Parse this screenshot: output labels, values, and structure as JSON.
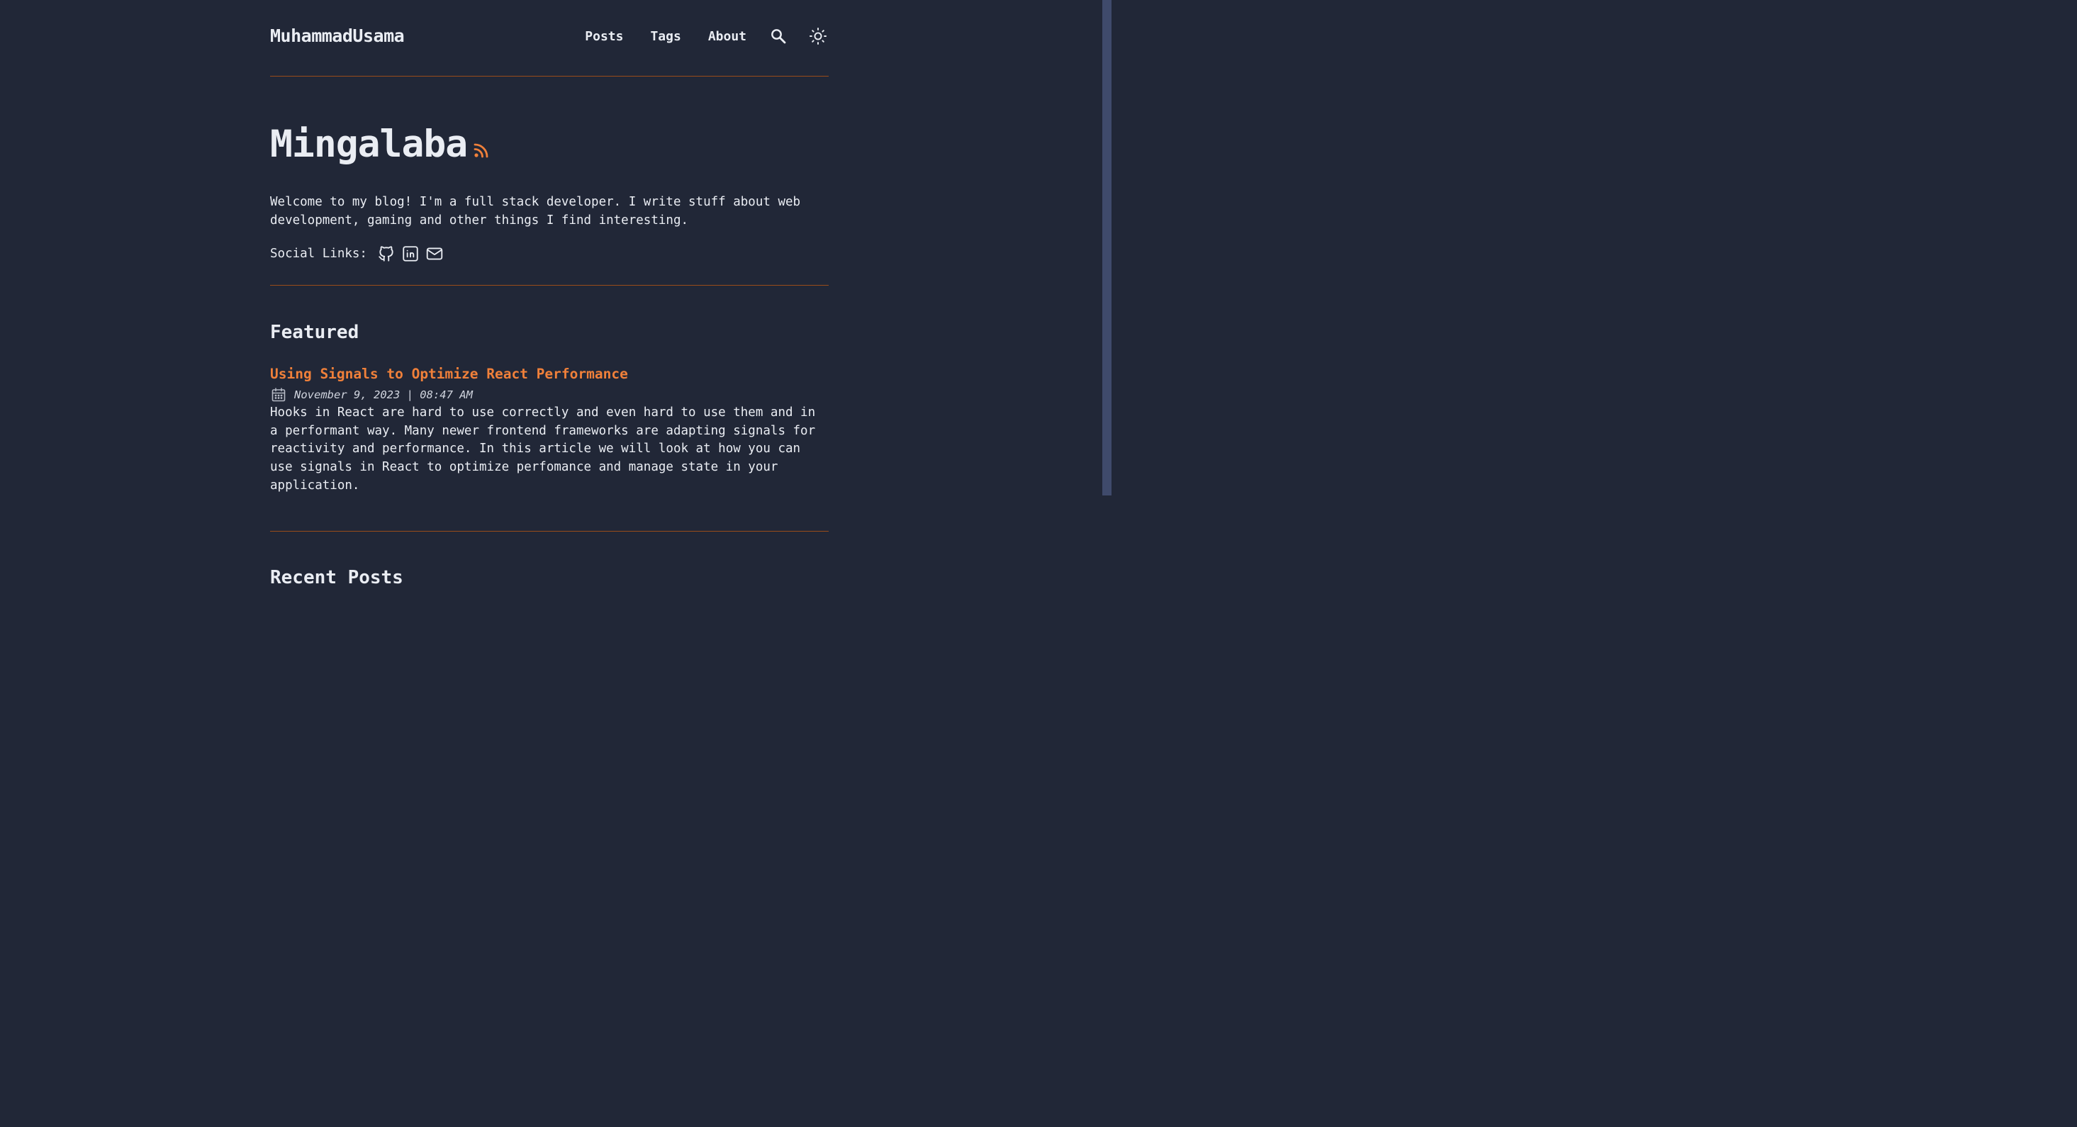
{
  "site": {
    "logo": "MuhammadUsama"
  },
  "nav": {
    "items": [
      "Posts",
      "Tags",
      "About"
    ],
    "search_icon": "search-icon",
    "theme_icon": "sun-icon"
  },
  "hero": {
    "title": "Mingalaba",
    "rss_icon": "rss-icon",
    "intro": "Welcome to my blog! I'm a full stack developer. I write stuff about web development, gaming and other things I find interesting.",
    "social_label": "Social Links:",
    "social_icons": [
      "github-icon",
      "linkedin-icon",
      "mail-icon"
    ]
  },
  "featured": {
    "heading": "Featured",
    "post": {
      "title": "Using Signals to Optimize React Performance",
      "date": "November 9, 2023 | 08:47 AM",
      "description": "Hooks in React are hard to use correctly and even hard to use them and in a performant way. Many newer frontend frameworks are adapting signals for reactivity and performance. In this article we will look at how you can use signals in React to optimize perfomance and manage state in your application."
    }
  },
  "recent": {
    "heading": "Recent Posts"
  },
  "colors": {
    "background": "#212737",
    "text": "#eaedf3",
    "accent": "#ff6b01",
    "scroll_thumb": "#3f4a6b"
  }
}
